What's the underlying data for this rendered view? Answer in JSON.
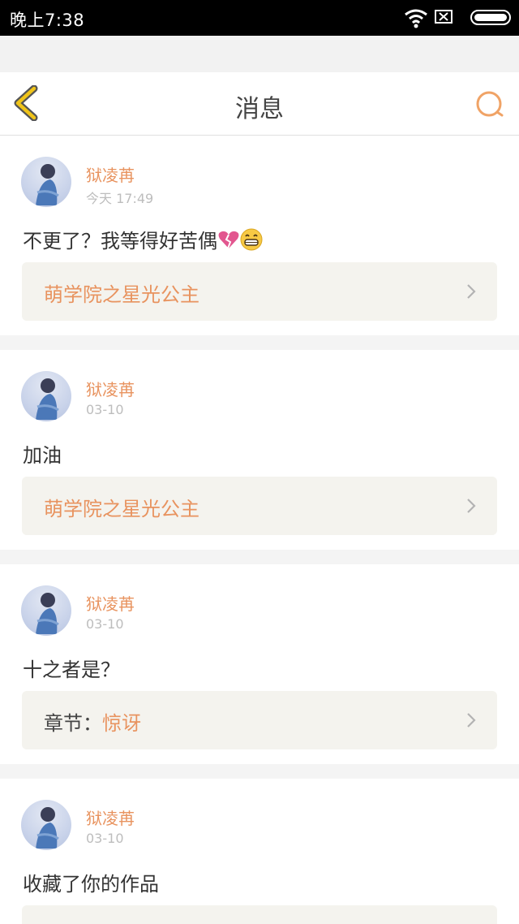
{
  "status_bar": {
    "time": "晚上7:38"
  },
  "header": {
    "title": "消息"
  },
  "messages": [
    {
      "user": "狱凌苒",
      "time": "今天 17:49",
      "text": "不更了？我等得好苦偶",
      "emojis": [
        "broken-heart",
        "grinning-face"
      ],
      "link": {
        "prefix": "",
        "label": "萌学院之星光公主"
      }
    },
    {
      "user": "狱凌苒",
      "time": "03-10",
      "text": "加油",
      "emojis": [],
      "link": {
        "prefix": "",
        "label": "萌学院之星光公主"
      }
    },
    {
      "user": "狱凌苒",
      "time": "03-10",
      "text": "十之者是？",
      "emojis": [],
      "link": {
        "prefix": "章节：",
        "label": "惊讶"
      }
    },
    {
      "user": "狱凌苒",
      "time": "03-10",
      "text": "收藏了你的作品",
      "emojis": []
    }
  ],
  "colors": {
    "accent": "#e8935f",
    "back_icon": "#f0c419"
  }
}
